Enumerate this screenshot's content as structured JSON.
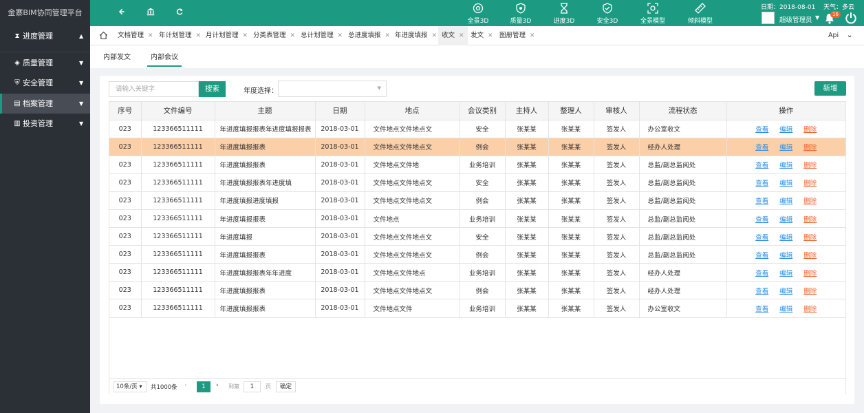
{
  "app": {
    "title": "金寨BIM协同管理平台"
  },
  "topbar": {
    "modules": [
      {
        "label": "全景3D",
        "icon": "compass-icon"
      },
      {
        "label": "质量3D",
        "icon": "shield-icon"
      },
      {
        "label": "进度3D",
        "icon": "hourglass-icon"
      },
      {
        "label": "安全3D",
        "icon": "shield-check-icon"
      },
      {
        "label": "全景模型",
        "icon": "scan-icon"
      },
      {
        "label": "倾斜模型",
        "icon": "ruler-icon"
      }
    ],
    "date_text": "日期：2018-08-01",
    "weather_text": "天气：多云",
    "username": "超级管理员",
    "notification_count": "16"
  },
  "sidebar": {
    "items": [
      {
        "label": "进度管理",
        "icon": "hourglass-icon",
        "arrow": "▲"
      },
      {
        "label": "质量管理",
        "icon": "layers-icon",
        "arrow": "▼"
      },
      {
        "label": "安全管理",
        "icon": "shield-icon",
        "arrow": "▼"
      },
      {
        "label": "档案管理",
        "icon": "archive-icon",
        "arrow": "▼"
      },
      {
        "label": "投资管理",
        "icon": "chart-icon",
        "arrow": "▼"
      }
    ]
  },
  "tabs": [
    {
      "label": "文档管理"
    },
    {
      "label": "年计划管理"
    },
    {
      "label": "月计划管理"
    },
    {
      "label": "分类表管理"
    },
    {
      "label": "总计划管理"
    },
    {
      "label": "总进度填报"
    },
    {
      "label": "年进度填报"
    },
    {
      "label": "收文"
    },
    {
      "label": "发文"
    },
    {
      "label": "图册管理"
    }
  ],
  "tabs_right": {
    "api_label": "Api"
  },
  "subtabs": {
    "internal_doc": "内部发文",
    "internal_meeting": "内部会议"
  },
  "toolbar": {
    "search_placeholder": "请输入关键字",
    "search_label": "搜索",
    "year_label": "年度选择：",
    "year_value": "",
    "add_label": "新增"
  },
  "table": {
    "headers": [
      "序号",
      "文件编号",
      "主题",
      "日期",
      "地点",
      "会议类别",
      "主持人",
      "整理人",
      "审核人",
      "流程状态",
      "操作"
    ],
    "rows": [
      [
        "023",
        "123366511111",
        "年进度填报报表年进度填报报表",
        "2018-03-01",
        "文件地点文件地点文",
        "安全",
        "张某某",
        "张某某",
        "签发人",
        "办公室收文"
      ],
      [
        "023",
        "123366511111",
        "年进度填报报表",
        "2018-03-01",
        "文件地点文件地点文",
        "例会",
        "张某某",
        "张某某",
        "签发人",
        "经办人处理"
      ],
      [
        "023",
        "123366511111",
        "年进度填报报表",
        "2018-03-01",
        "文件地点文件地",
        "业务培训",
        "张某某",
        "张某某",
        "签发人",
        "总监/副总监阅处"
      ],
      [
        "023",
        "123366511111",
        "年进度填报报表年进度填",
        "2018-03-01",
        "文件地点文件地点文",
        "安全",
        "张某某",
        "张某某",
        "签发人",
        "总监/副总监阅处"
      ],
      [
        "023",
        "123366511111",
        "年进度填报进度填报",
        "2018-03-01",
        "文件地点文件地点文",
        "例会",
        "张某某",
        "张某某",
        "签发人",
        "总监/副总监阅处"
      ],
      [
        "023",
        "123366511111",
        "年进度填报报表",
        "2018-03-01",
        "文件地点",
        "业务培训",
        "张某某",
        "张某某",
        "签发人",
        "总监/副总监阅处"
      ],
      [
        "023",
        "123366511111",
        "年进度填报",
        "2018-03-01",
        "文件地点文件地点文",
        "安全",
        "张某某",
        "张某某",
        "签发人",
        "总监/副总监阅处"
      ],
      [
        "023",
        "123366511111",
        "年进度填报报表",
        "2018-03-01",
        "文件地点文件地点文",
        "例会",
        "张某某",
        "张某某",
        "签发人",
        "总监/副总监阅处"
      ],
      [
        "023",
        "123366511111",
        "年进度填报报表年年进度",
        "2018-03-01",
        "文件地点文件地点",
        "业务培训",
        "张某某",
        "张某某",
        "签发人",
        "经办人处理"
      ],
      [
        "023",
        "123366511111",
        "年进度填报报表",
        "2018-03-01",
        "文件地点文件地点文",
        "例会",
        "张某某",
        "张某某",
        "签发人",
        "经办人处理"
      ],
      [
        "023",
        "123366511111",
        "年进度填报报表",
        "2018-03-01",
        "文件地点文件",
        "业务培训",
        "张某某",
        "张某某",
        "签发人",
        "办公室收文"
      ]
    ],
    "actions": {
      "view": "查看",
      "edit": "编辑",
      "delete": "删除"
    }
  },
  "pagination": {
    "page_size": "10条/页",
    "total": "共1000条",
    "current_page": "1",
    "goto_label": "到第",
    "goto_value": "1",
    "page_label": "页",
    "confirm_label": "确定"
  },
  "colors": {
    "primary": "#1d9a82",
    "sidebar": "#2b2f36",
    "highlight_row": "#fbcfa8",
    "link": "#2b8ee6",
    "danger": "#f0642d"
  }
}
